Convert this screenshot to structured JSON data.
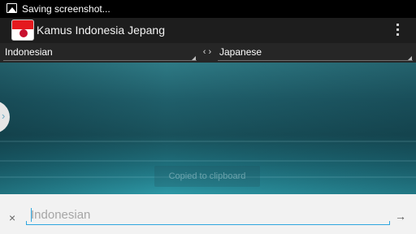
{
  "status_bar": {
    "notification_icon": "image-icon",
    "text": "Saving screenshot..."
  },
  "action_bar": {
    "logo_icon": "indonesia-japan-flag-icon",
    "title": "Kamus Indonesia Jepang",
    "menu_icon": "overflow-menu-icon"
  },
  "language_bar": {
    "source_language": "Indonesian",
    "swap_label": "‹ ›",
    "target_language": "Japanese"
  },
  "content": {
    "drawer_handle_glyph": "›",
    "toast": "Copied to clipboard"
  },
  "input_bar": {
    "clear_glyph": "×",
    "placeholder": "Indonesian",
    "value": "",
    "submit_glyph": "→"
  },
  "colors": {
    "accent": "#2fa6df",
    "action_bar_bg": "#1d1d1d",
    "input_bar_bg": "#f2f2f2"
  }
}
